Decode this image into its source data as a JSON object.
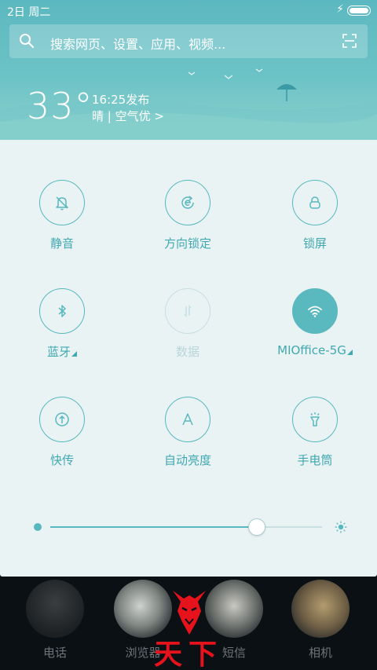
{
  "status_bar": {
    "date": "2日 周二",
    "charging_icon": "bolt-icon",
    "battery_icon": "battery-icon"
  },
  "search": {
    "placeholder": "搜索网页、设置、应用、视频...",
    "icon": "search-icon",
    "scan_icon": "scan-icon"
  },
  "weather": {
    "temperature": "33°",
    "time": "16:25发布",
    "description": "晴 | 空气优 >"
  },
  "toggles": [
    {
      "label": "静音",
      "icon": "bell-off-icon",
      "state": "off"
    },
    {
      "label": "方向锁定",
      "icon": "rotation-lock-icon",
      "state": "off"
    },
    {
      "label": "锁屏",
      "icon": "lock-icon",
      "state": "off"
    },
    {
      "label": "蓝牙",
      "icon": "bluetooth-icon",
      "state": "off"
    },
    {
      "label": "数据",
      "icon": "data-icon",
      "state": "disabled"
    },
    {
      "label": "MIOffice-5G",
      "icon": "wifi-icon",
      "state": "on"
    },
    {
      "label": "快传",
      "icon": "transfer-icon",
      "state": "off"
    },
    {
      "label": "自动亮度",
      "icon": "auto-brightness-icon",
      "state": "off"
    },
    {
      "label": "手电筒",
      "icon": "flashlight-icon",
      "state": "off"
    }
  ],
  "brightness": {
    "level": 0.76
  },
  "dock": {
    "apps": [
      {
        "label": "电话",
        "icon": "phone-app-icon"
      },
      {
        "label": "浏览器",
        "icon": "browser-app-icon"
      },
      {
        "label": "短信",
        "icon": "messages-app-icon"
      },
      {
        "label": "相机",
        "icon": "camera-app-icon"
      }
    ],
    "overlay_text": "天下"
  },
  "colors": {
    "accent": "#57b8bf",
    "label": "#3fa8b0",
    "panel": "#eaf3f4",
    "header": "#5cb8c0",
    "brand_red": "#e6121c"
  }
}
